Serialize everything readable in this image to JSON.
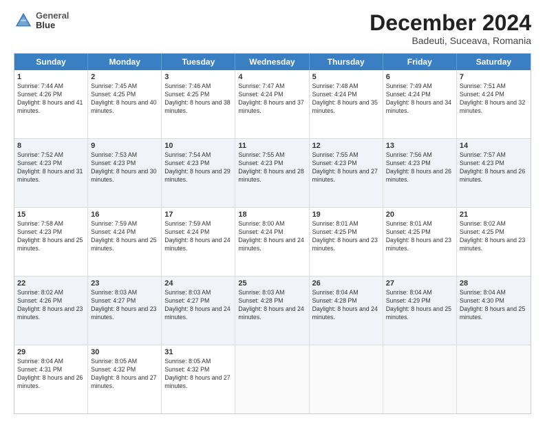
{
  "logo": {
    "line1": "General",
    "line2": "Blue"
  },
  "title": "December 2024",
  "subtitle": "Badeuti, Suceava, Romania",
  "days": [
    "Sunday",
    "Monday",
    "Tuesday",
    "Wednesday",
    "Thursday",
    "Friday",
    "Saturday"
  ],
  "weeks": [
    [
      {
        "num": "1",
        "rise": "7:44 AM",
        "set": "4:26 PM",
        "daylight": "8 hours and 41 minutes."
      },
      {
        "num": "2",
        "rise": "7:45 AM",
        "set": "4:25 PM",
        "daylight": "8 hours and 40 minutes."
      },
      {
        "num": "3",
        "rise": "7:46 AM",
        "set": "4:25 PM",
        "daylight": "8 hours and 38 minutes."
      },
      {
        "num": "4",
        "rise": "7:47 AM",
        "set": "4:24 PM",
        "daylight": "8 hours and 37 minutes."
      },
      {
        "num": "5",
        "rise": "7:48 AM",
        "set": "4:24 PM",
        "daylight": "8 hours and 35 minutes."
      },
      {
        "num": "6",
        "rise": "7:49 AM",
        "set": "4:24 PM",
        "daylight": "8 hours and 34 minutes."
      },
      {
        "num": "7",
        "rise": "7:51 AM",
        "set": "4:24 PM",
        "daylight": "8 hours and 32 minutes."
      }
    ],
    [
      {
        "num": "8",
        "rise": "7:52 AM",
        "set": "4:23 PM",
        "daylight": "8 hours and 31 minutes."
      },
      {
        "num": "9",
        "rise": "7:53 AM",
        "set": "4:23 PM",
        "daylight": "8 hours and 30 minutes."
      },
      {
        "num": "10",
        "rise": "7:54 AM",
        "set": "4:23 PM",
        "daylight": "8 hours and 29 minutes."
      },
      {
        "num": "11",
        "rise": "7:55 AM",
        "set": "4:23 PM",
        "daylight": "8 hours and 28 minutes."
      },
      {
        "num": "12",
        "rise": "7:55 AM",
        "set": "4:23 PM",
        "daylight": "8 hours and 27 minutes."
      },
      {
        "num": "13",
        "rise": "7:56 AM",
        "set": "4:23 PM",
        "daylight": "8 hours and 26 minutes."
      },
      {
        "num": "14",
        "rise": "7:57 AM",
        "set": "4:23 PM",
        "daylight": "8 hours and 26 minutes."
      }
    ],
    [
      {
        "num": "15",
        "rise": "7:58 AM",
        "set": "4:23 PM",
        "daylight": "8 hours and 25 minutes."
      },
      {
        "num": "16",
        "rise": "7:59 AM",
        "set": "4:24 PM",
        "daylight": "8 hours and 25 minutes."
      },
      {
        "num": "17",
        "rise": "7:59 AM",
        "set": "4:24 PM",
        "daylight": "8 hours and 24 minutes."
      },
      {
        "num": "18",
        "rise": "8:00 AM",
        "set": "4:24 PM",
        "daylight": "8 hours and 24 minutes."
      },
      {
        "num": "19",
        "rise": "8:01 AM",
        "set": "4:25 PM",
        "daylight": "8 hours and 23 minutes."
      },
      {
        "num": "20",
        "rise": "8:01 AM",
        "set": "4:25 PM",
        "daylight": "8 hours and 23 minutes."
      },
      {
        "num": "21",
        "rise": "8:02 AM",
        "set": "4:25 PM",
        "daylight": "8 hours and 23 minutes."
      }
    ],
    [
      {
        "num": "22",
        "rise": "8:02 AM",
        "set": "4:26 PM",
        "daylight": "8 hours and 23 minutes."
      },
      {
        "num": "23",
        "rise": "8:03 AM",
        "set": "4:27 PM",
        "daylight": "8 hours and 23 minutes."
      },
      {
        "num": "24",
        "rise": "8:03 AM",
        "set": "4:27 PM",
        "daylight": "8 hours and 24 minutes."
      },
      {
        "num": "25",
        "rise": "8:03 AM",
        "set": "4:28 PM",
        "daylight": "8 hours and 24 minutes."
      },
      {
        "num": "26",
        "rise": "8:04 AM",
        "set": "4:28 PM",
        "daylight": "8 hours and 24 minutes."
      },
      {
        "num": "27",
        "rise": "8:04 AM",
        "set": "4:29 PM",
        "daylight": "8 hours and 25 minutes."
      },
      {
        "num": "28",
        "rise": "8:04 AM",
        "set": "4:30 PM",
        "daylight": "8 hours and 25 minutes."
      }
    ],
    [
      {
        "num": "29",
        "rise": "8:04 AM",
        "set": "4:31 PM",
        "daylight": "8 hours and 26 minutes."
      },
      {
        "num": "30",
        "rise": "8:05 AM",
        "set": "4:32 PM",
        "daylight": "8 hours and 27 minutes."
      },
      {
        "num": "31",
        "rise": "8:05 AM",
        "set": "4:32 PM",
        "daylight": "8 hours and 27 minutes."
      },
      null,
      null,
      null,
      null
    ]
  ]
}
